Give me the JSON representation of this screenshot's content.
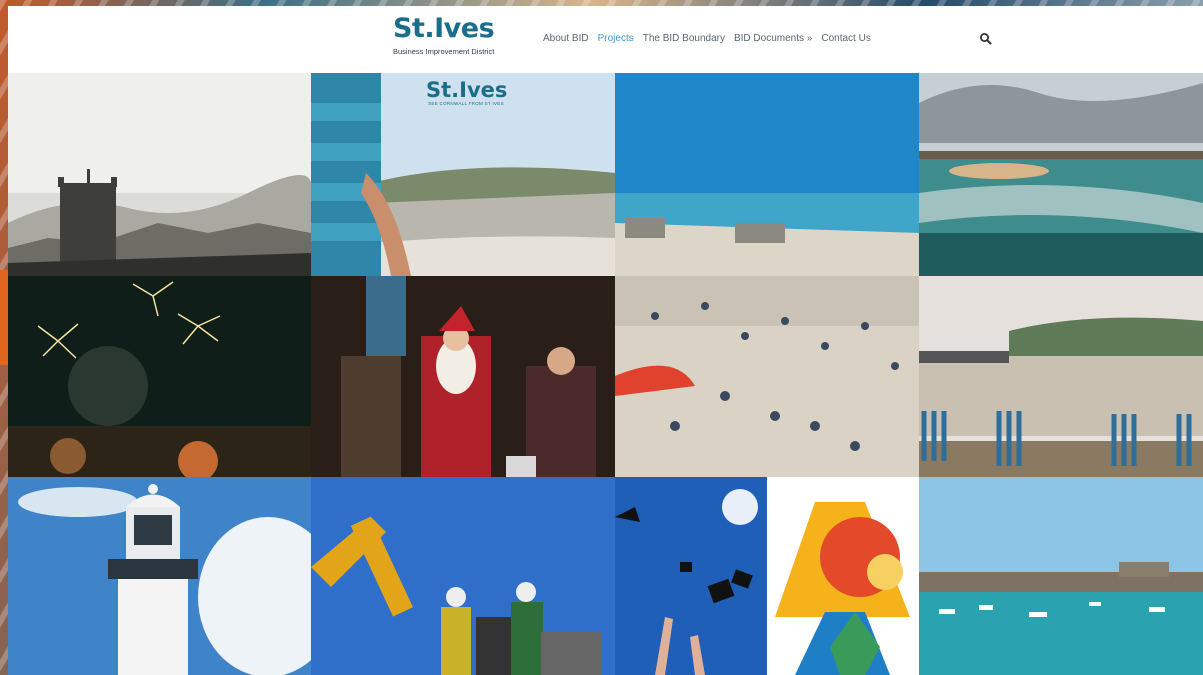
{
  "header": {
    "logo_title": "St.Ives",
    "logo_subtitle": "Business Improvement District"
  },
  "nav": {
    "items": [
      {
        "label": "About BID",
        "active": false
      },
      {
        "label": "Projects",
        "active": true
      },
      {
        "label": "The BID Boundary",
        "active": false
      },
      {
        "label": "BID Documents »",
        "active": false
      },
      {
        "label": "Contact Us",
        "active": false
      }
    ],
    "search_icon": "search-icon"
  },
  "colors": {
    "brand": "#1b6e8a",
    "nav_active": "#3b9ad6",
    "nav_text": "#5a6770"
  },
  "gallery": {
    "overlay_title": "St.Ives",
    "overlay_tagline": "SEE CORNWALL FROM ST IVES"
  }
}
